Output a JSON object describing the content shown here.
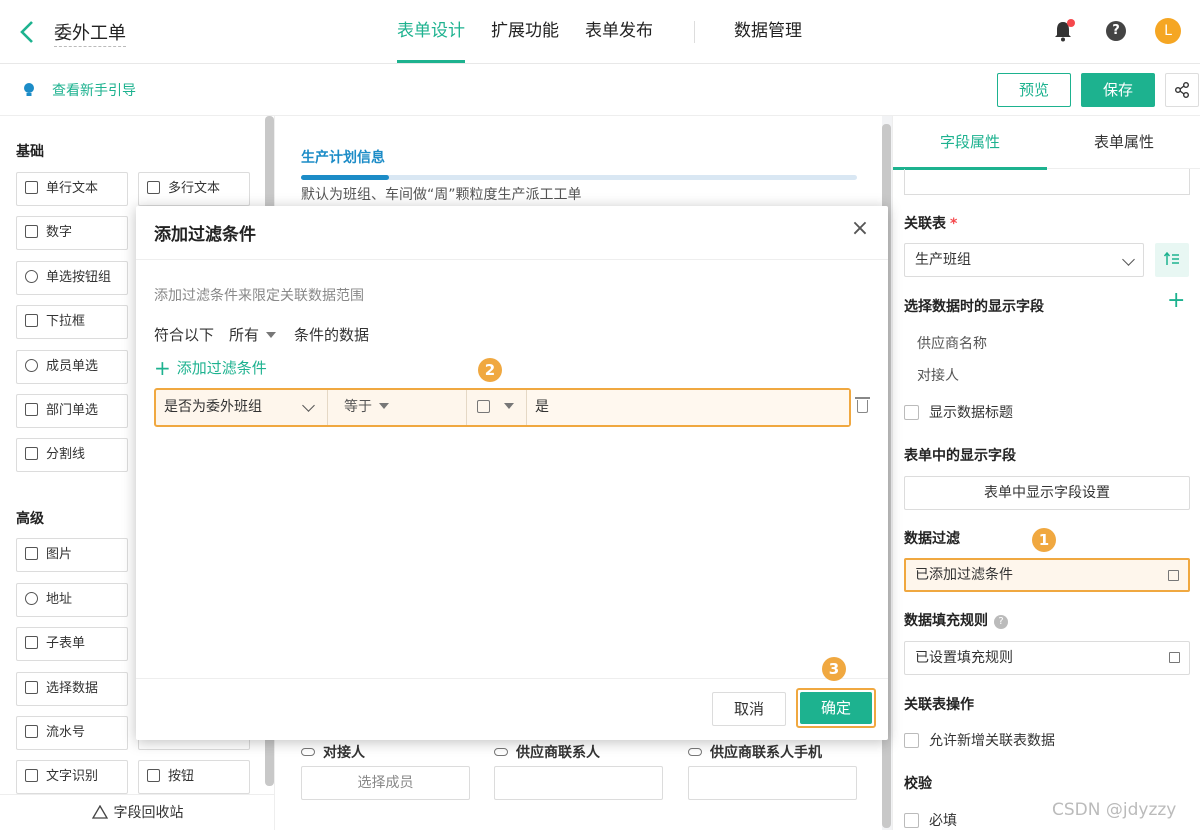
{
  "header": {
    "app_title": "委外工单",
    "tabs": [
      {
        "label": "表单设计"
      },
      {
        "label": "扩展功能"
      },
      {
        "label": "表单发布"
      },
      {
        "label": "数据管理"
      }
    ],
    "avatar_letter": "L",
    "help_label": "?"
  },
  "subbar": {
    "guide_link": "查看新手引导",
    "preview_label": "预览",
    "save_label": "保存"
  },
  "palette": {
    "basic_title": "基础",
    "basic_items": [
      "单行文本",
      "多行文本",
      "数字",
      "单选按钮组",
      "下拉框",
      "成员单选",
      "部门单选",
      "分割线"
    ],
    "advanced_title": "高级",
    "advanced_items": [
      "图片",
      "地址",
      "子表单",
      "选择数据",
      "流水号",
      "文字识别",
      "按钮"
    ],
    "recycle_label": "字段回收站"
  },
  "canvas": {
    "section_name": "生产计划信息",
    "section_desc": "默认为班组、车间做“周”颗粒度生产派工工单",
    "bottom_fields": [
      {
        "label": "对接人",
        "value": "选择成员"
      },
      {
        "label": "供应商联系人",
        "value": ""
      },
      {
        "label": "供应商联系人手机",
        "value": ""
      }
    ]
  },
  "right_panel": {
    "tabs": [
      "字段属性",
      "表单属性"
    ],
    "related_table_label": "关联表",
    "related_table_required": "*",
    "related_table_value": "生产班组",
    "display_fields_label": "选择数据时的显示字段",
    "display_fields": [
      "供应商名称",
      "对接人"
    ],
    "show_title_label": "显示数据标题",
    "form_display_label": "表单中的显示字段",
    "form_display_button": "表单中显示字段设置",
    "data_filter_label": "数据过滤",
    "data_filter_value": "已添加过滤条件",
    "fill_rule_label": "数据填充规则",
    "fill_rule_value": "已设置填充规则",
    "related_ops_label": "关联表操作",
    "allow_add_label": "允许新增关联表数据",
    "validate_label": "校验",
    "required_label": "必填"
  },
  "modal": {
    "title": "添加过滤条件",
    "description": "添加过滤条件来限定关联数据范围",
    "match_prefix": "符合以下",
    "match_mode": "所有",
    "match_suffix": "条件的数据",
    "add_condition": "添加过滤条件",
    "condition": {
      "field": "是否为委外班组",
      "operator": "等于",
      "value": "是"
    },
    "cancel_label": "取消",
    "confirm_label": "确定"
  },
  "badges": [
    "1",
    "2",
    "3"
  ],
  "colors": {
    "accent": "#1db28f",
    "highlight": "#f0a840",
    "section_blue": "#1c8cc7"
  },
  "watermark": "CSDN @jdyzzy"
}
